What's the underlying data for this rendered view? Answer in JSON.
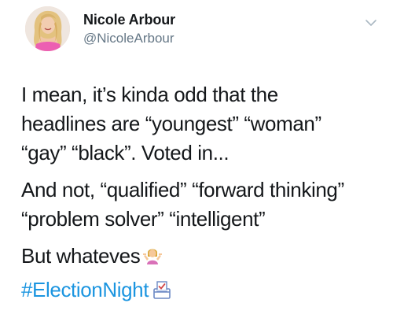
{
  "user": {
    "display_name": "Nicole Arbour",
    "handle": "@NicoleArbour"
  },
  "tweet": {
    "paragraphs": [
      {
        "lines": [
          "I mean, it’s kinda odd that the",
          "headlines are “youngest” “woman”",
          "“gay” “black”. Voted in..."
        ]
      },
      {
        "lines": [
          "And not, “qualified” “forward thinking”",
          "“problem solver” “intelligent”"
        ]
      },
      {
        "lines": [
          "But whateves"
        ]
      }
    ],
    "hashtag": "#ElectionNight"
  },
  "icons": {
    "menu": "chevron-down-icon",
    "emoji_1": "person-shrugging-emoji",
    "emoji_2": "ballot-box-emoji"
  },
  "colors": {
    "text": "#14171a",
    "secondary": "#657786",
    "link": "#1b95e0"
  }
}
